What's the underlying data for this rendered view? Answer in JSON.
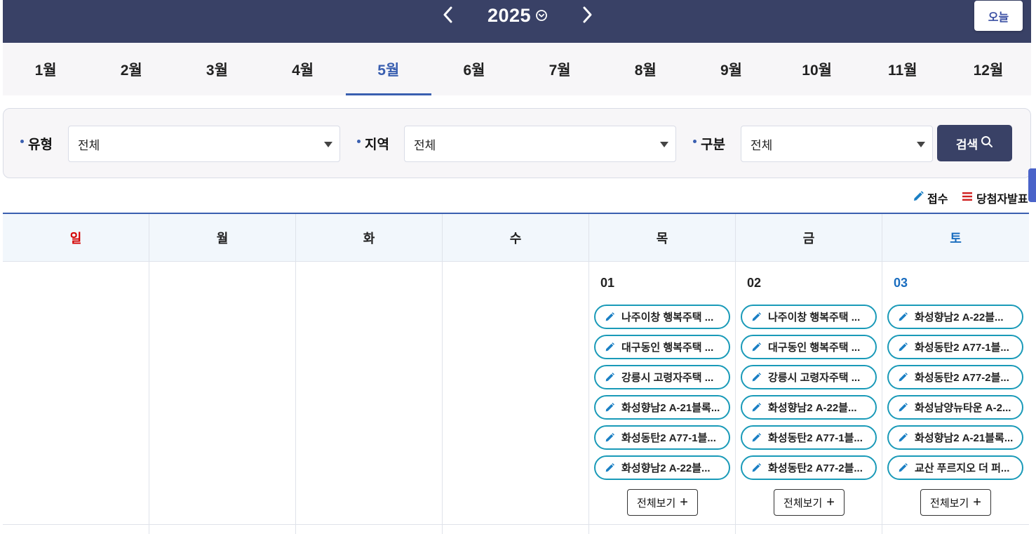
{
  "header": {
    "year": "2025",
    "today_label": "오늘",
    "prev_icon": "chevron-left-icon",
    "next_icon": "chevron-right-icon"
  },
  "months": [
    "1월",
    "2월",
    "3월",
    "4월",
    "5월",
    "6월",
    "7월",
    "8월",
    "9월",
    "10월",
    "11월",
    "12월"
  ],
  "active_month_index": 4,
  "filters": {
    "type": {
      "label": "유형",
      "value": "전체"
    },
    "region": {
      "label": "지역",
      "value": "전체"
    },
    "category": {
      "label": "구분",
      "value": "전체"
    },
    "search_label": "검색"
  },
  "legend": {
    "receipt": "접수",
    "winner": "당첨자발표"
  },
  "colors": {
    "header_bg": "#394166",
    "accent": "#3a5fb0",
    "event_border": "#1a9ab8",
    "sunday": "#d40000",
    "saturday": "#1a6dbf"
  },
  "weekdays": [
    "일",
    "월",
    "화",
    "수",
    "목",
    "금",
    "토"
  ],
  "days": [
    {
      "date": "01",
      "events": [
        "나주이창 행복주택 ...",
        "대구동인 행복주택 ...",
        "강릉시 고령자주택 ...",
        "화성향남2 A-21블록...",
        "화성동탄2 A77-1블...",
        "화성향남2 A-22블..."
      ],
      "more_label": "전체보기"
    },
    {
      "date": "02",
      "events": [
        "나주이창 행복주택 ...",
        "대구동인 행복주택 ...",
        "강릉시 고령자주택 ...",
        "화성향남2 A-22블...",
        "화성동탄2 A77-1블...",
        "화성동탄2 A77-2블..."
      ],
      "more_label": "전체보기"
    },
    {
      "date": "03",
      "events": [
        "화성향남2 A-22블...",
        "화성동탄2 A77-1블...",
        "화성동탄2 A77-2블...",
        "화성남양뉴타운 A-2...",
        "화성향남2 A-21블록...",
        "교산 푸르지오 더 퍼..."
      ],
      "more_label": "전체보기"
    }
  ]
}
